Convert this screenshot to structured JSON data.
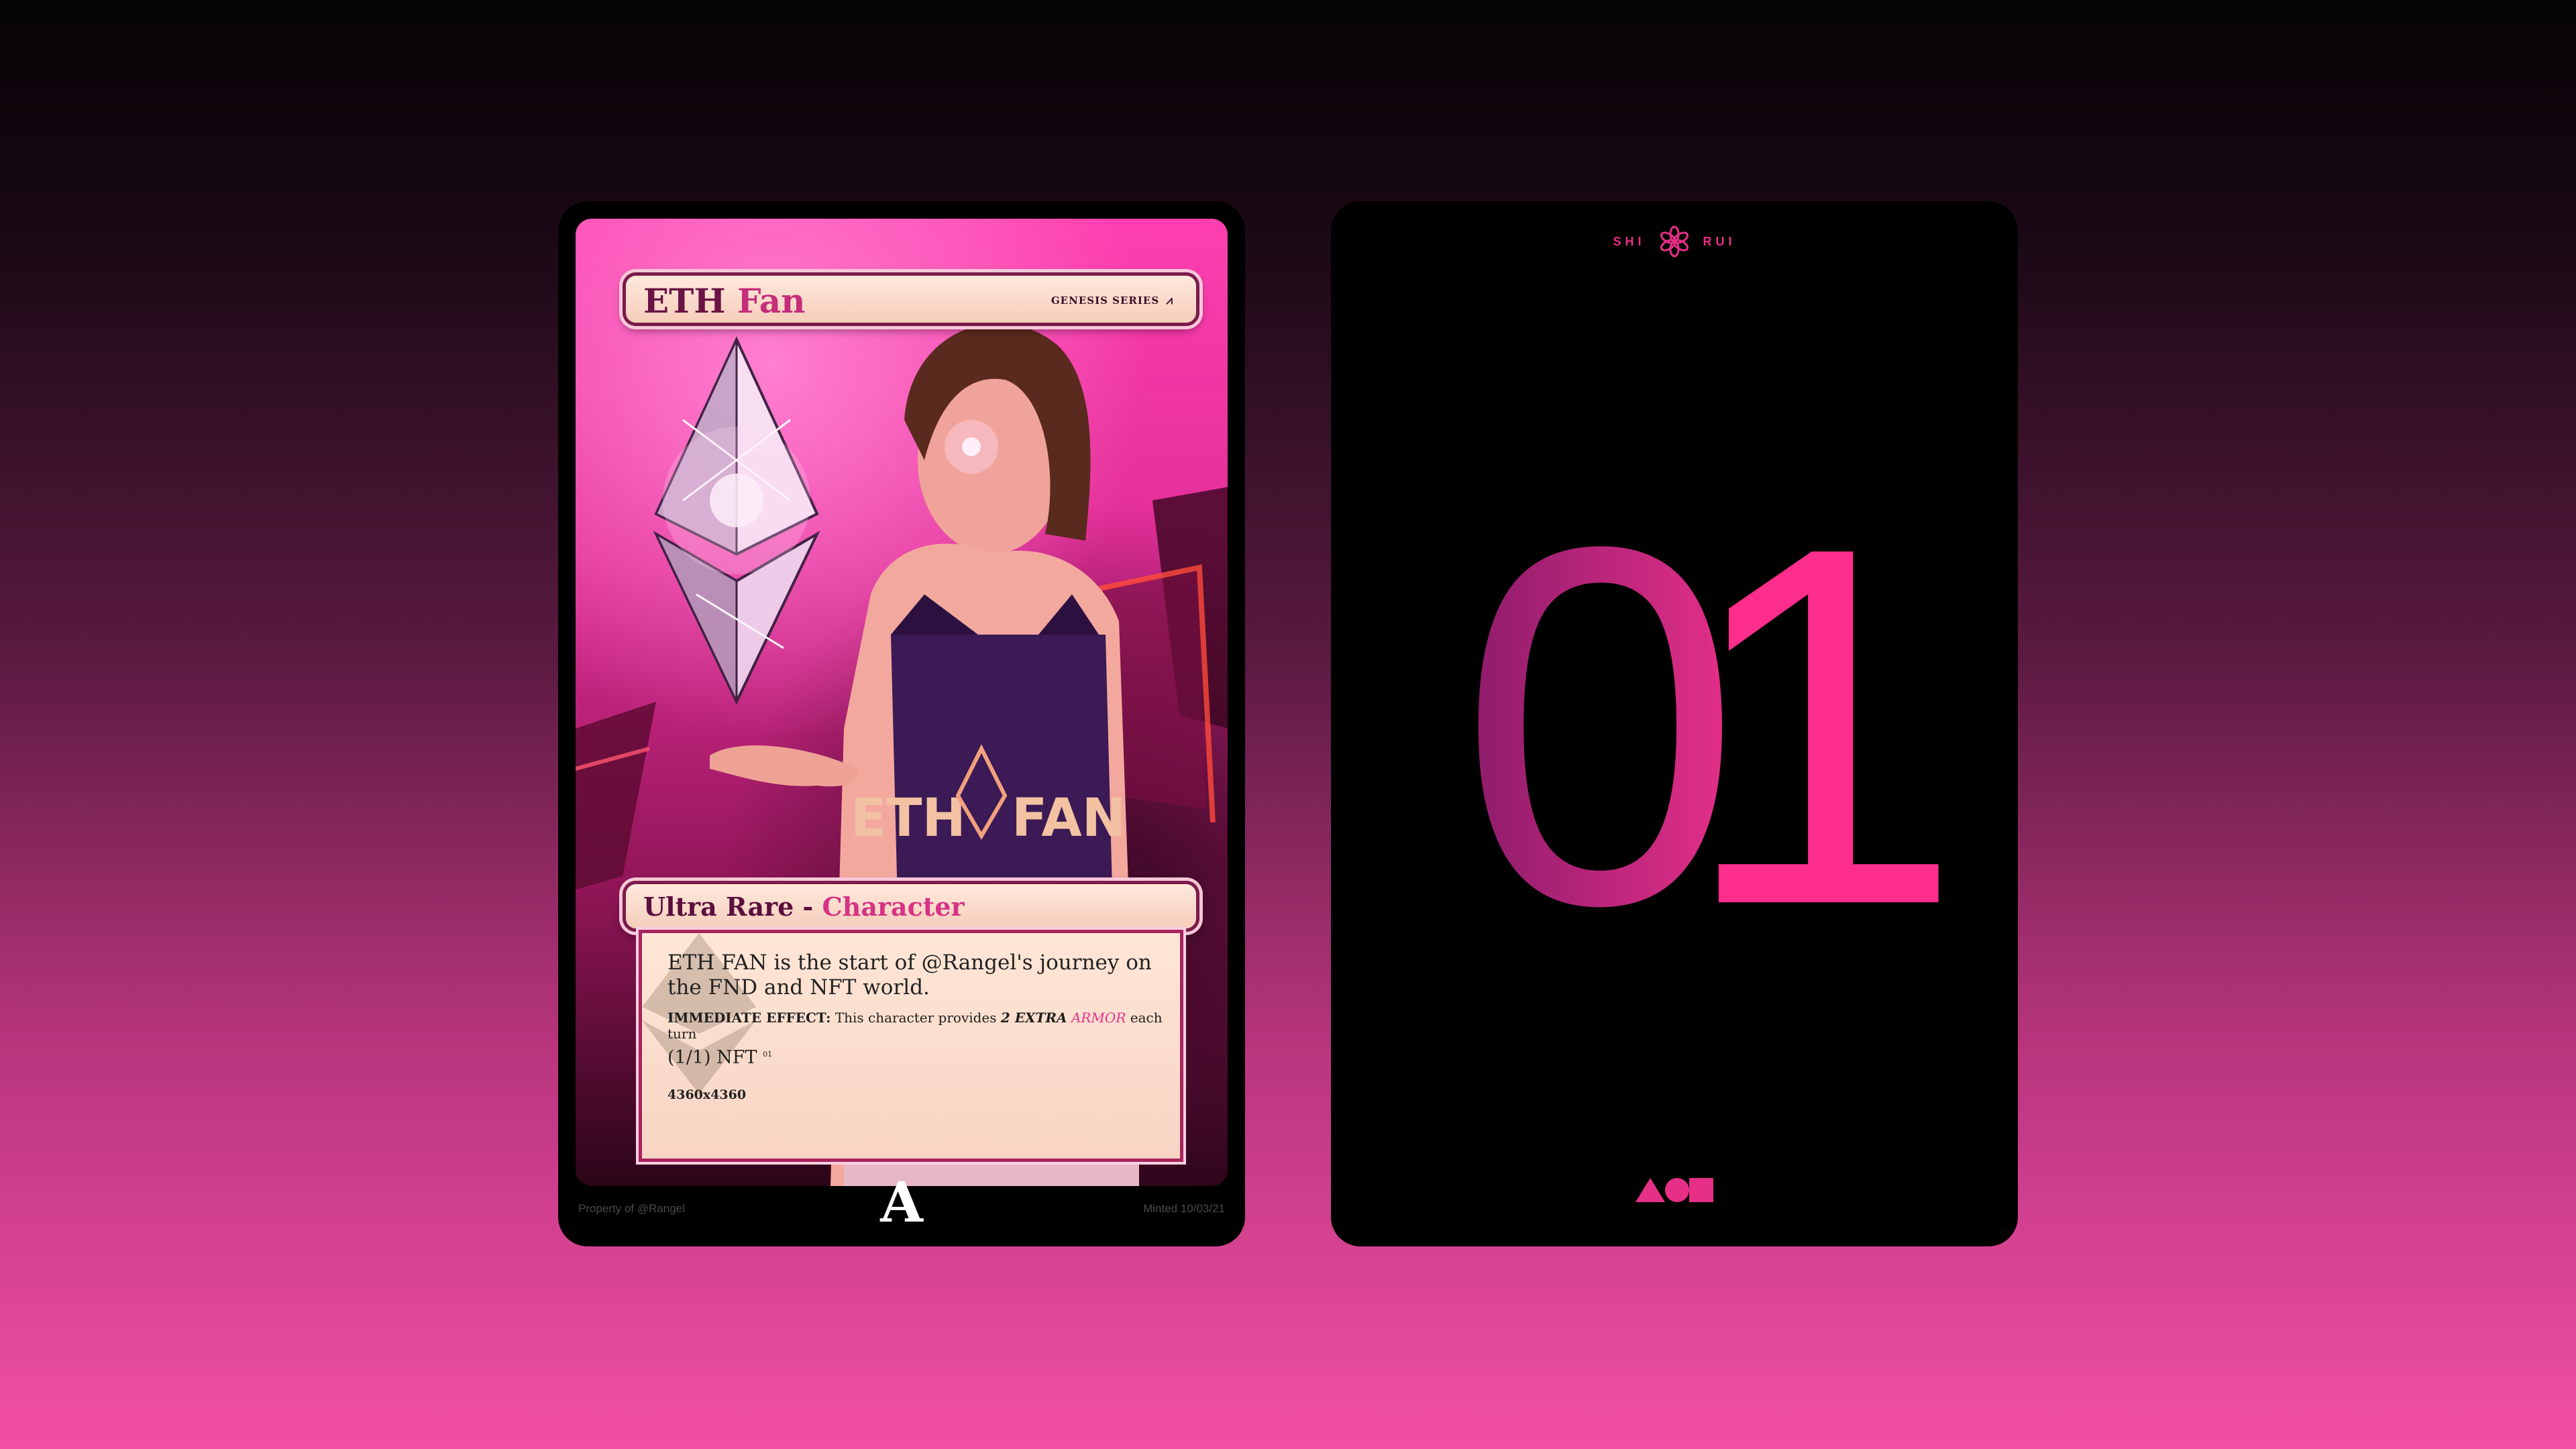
{
  "front_card": {
    "title": {
      "part1": "ETH",
      "part2": "Fan"
    },
    "series_label": "GENESIS SERIES",
    "series_mark": "⩘",
    "type_line": {
      "rarity": "Ultra Rare",
      "separator": " - ",
      "type": "Character"
    },
    "description": "ETH FAN is the start of @Rangel's journey on the FND and NFT world.",
    "effect": {
      "label": "IMMEDIATE EFFECT:",
      "text_before": "This character provides",
      "extra": "2 EXTRA",
      "armor": "ARMOR",
      "text_after": "each turn"
    },
    "edition": {
      "label": "(1/1) NFT",
      "superscript": "01"
    },
    "dimensions": "4360x4360",
    "footer_left": "Property of @Rangel",
    "footer_right": "Minted 10/03/21",
    "footer_logo": "A"
  },
  "back_card": {
    "brand_left": "SHI",
    "brand_right": "RUI",
    "number": "01",
    "bottom_icons": [
      "triangle-icon",
      "circle-icon",
      "square-icon"
    ]
  },
  "colors": {
    "accent_pink": "#e62f87",
    "banner_cream": "#ffe9dc",
    "card_black": "#000000"
  }
}
